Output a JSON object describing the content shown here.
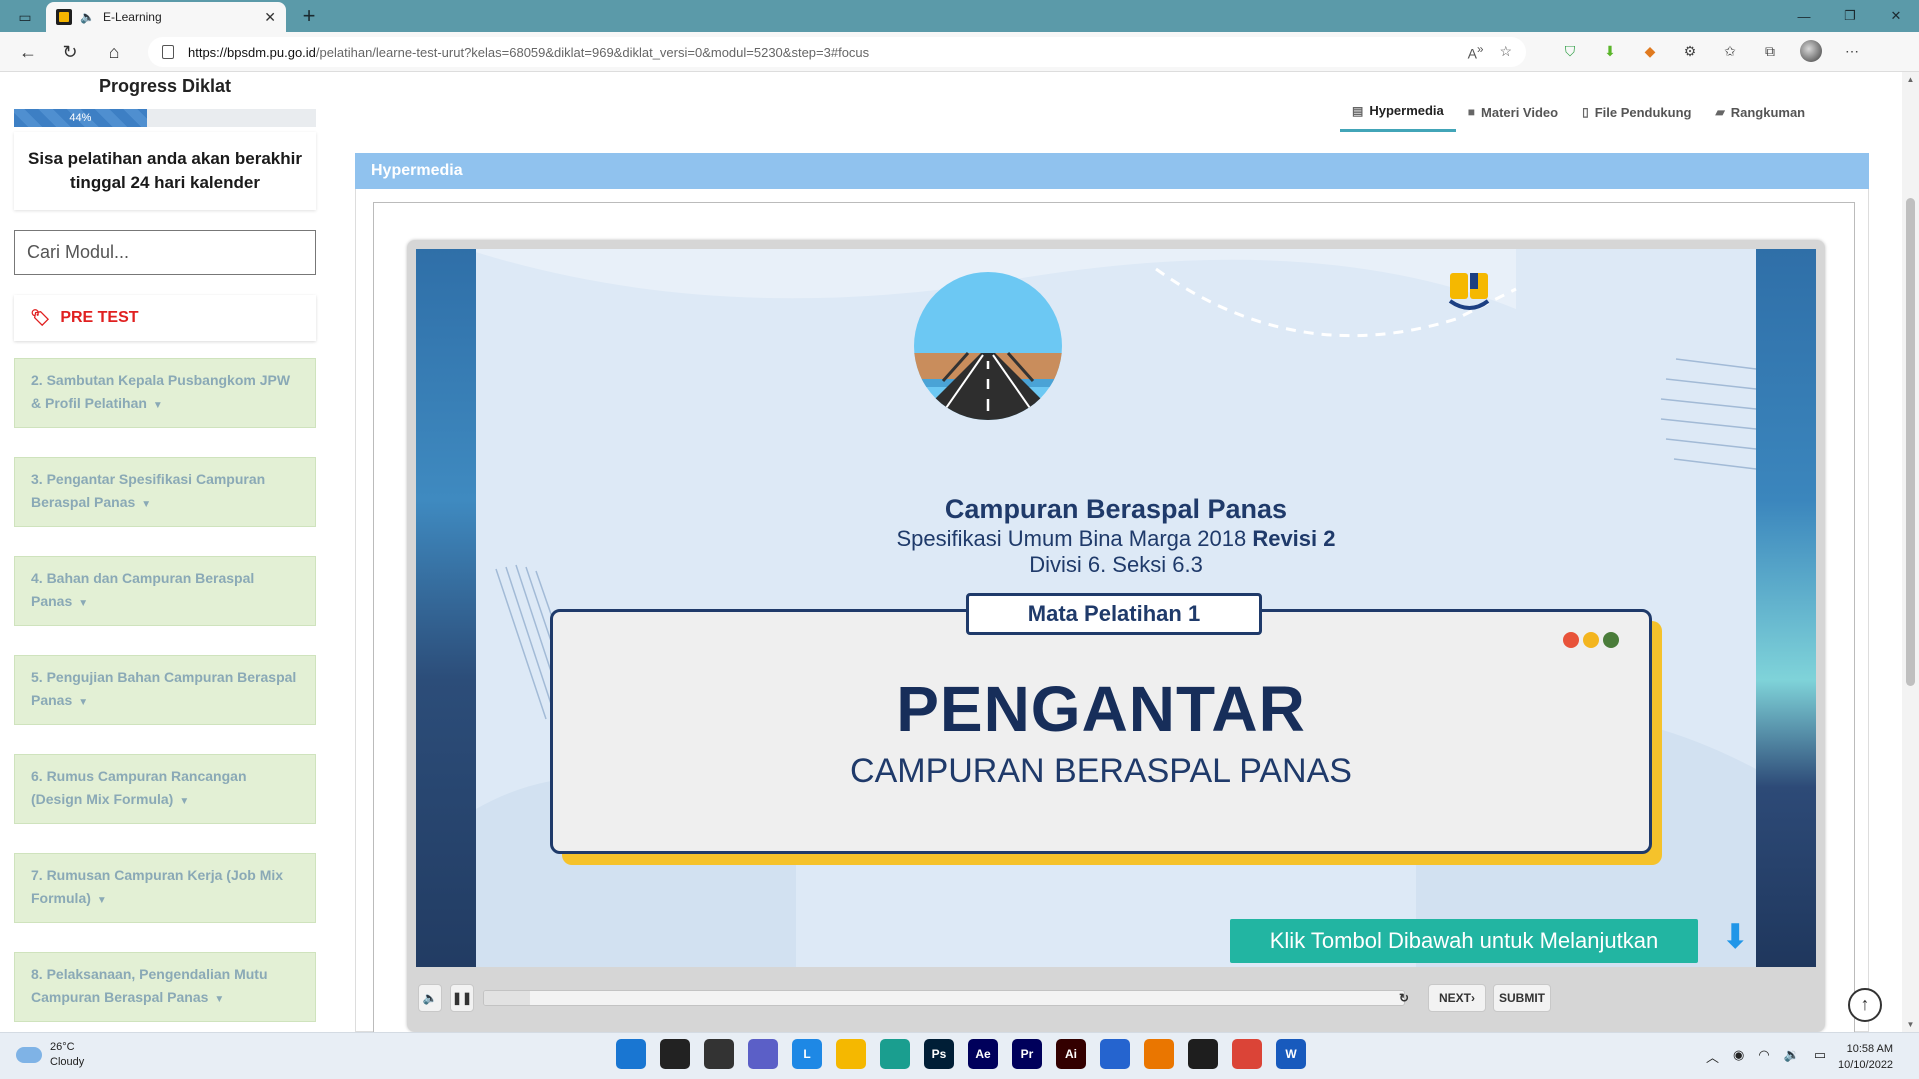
{
  "browser": {
    "tab_title": "E-Learning",
    "url_host": "https://bpsdm.pu.go.id",
    "url_path": "/pelatihan/learne-test-urut?kelas=68059&diklat=969&diklat_versi=0&modul=5230&step=3#focus"
  },
  "sidebar": {
    "progress_title": "Progress Diklat",
    "progress_percent": 44,
    "progress_label": "44%",
    "remaining_text": "Sisa pelatihan anda akan berakhir tinggal 24 hari kalender",
    "search_placeholder": "Cari Modul...",
    "pretest_label": "PRE TEST",
    "modules": [
      {
        "line1": "2. Sambutan Kepala Pusbangkom JPW",
        "line2": "& Profil Pelatihan"
      },
      {
        "line1": "3. Pengantar Spesifikasi Campuran",
        "line2": "Beraspal Panas"
      },
      {
        "line1": "4. Bahan dan Campuran Beraspal",
        "line2": "Panas"
      },
      {
        "line1": "5. Pengujian Bahan Campuran Beraspal",
        "line2": "Panas"
      },
      {
        "line1": "6. Rumus Campuran Rancangan",
        "line2": "(Design Mix Formula)"
      },
      {
        "line1": "7. Rumusan Campuran Kerja (Job Mix",
        "line2": "Formula)"
      },
      {
        "line1": "8. Pelaksanaan, Pengendalian Mutu",
        "line2": "Campuran Beraspal Panas"
      }
    ]
  },
  "content_tabs": {
    "hypermedia": "Hypermedia",
    "materi_video": "Materi Video",
    "file_pendukung": "File Pendukung",
    "rangkuman": "Rangkuman"
  },
  "panel": {
    "title": "Hypermedia"
  },
  "slide": {
    "title": "Campuran Beraspal Panas",
    "subtitle_prefix": "Spesifikasi Umum Bina Marga 2018",
    "subtitle_bold": "Revisi 2",
    "division": "Divisi 6. Seksi 6.3",
    "tag": "Mata Pelatihan 1",
    "heading": "PENGANTAR",
    "subheading": "CAMPURAN BERASPAL PANAS",
    "cta": "Klik Tombol Dibawah untuk Melanjutkan",
    "dot_colors": [
      "#e8533a",
      "#f3b51f",
      "#4a7c3a"
    ]
  },
  "player": {
    "next_label": "NEXT",
    "submit_label": "SUBMIT",
    "seek_progress": 0.05
  },
  "taskbar": {
    "temperature": "26°C",
    "weather": "Cloudy",
    "time": "10:58 AM",
    "date": "10/10/2022",
    "apps": [
      {
        "name": "windows-start",
        "label": "",
        "color": "#1976d2"
      },
      {
        "name": "search",
        "label": "",
        "color": "#222"
      },
      {
        "name": "task-view",
        "label": "",
        "color": "#333"
      },
      {
        "name": "chat",
        "label": "",
        "color": "#5b5fc7"
      },
      {
        "name": "lumina",
        "label": "L",
        "color": "#1e88e5"
      },
      {
        "name": "file-explorer",
        "label": "",
        "color": "#f5b800"
      },
      {
        "name": "edge",
        "label": "",
        "color": "#1a9e8f"
      },
      {
        "name": "photoshop",
        "label": "Ps",
        "color": "#001e36"
      },
      {
        "name": "after-effects",
        "label": "Ae",
        "color": "#00005b"
      },
      {
        "name": "premiere",
        "label": "Pr",
        "color": "#00005b"
      },
      {
        "name": "illustrator",
        "label": "Ai",
        "color": "#330000"
      },
      {
        "name": "todo",
        "label": "",
        "color": "#2564cf"
      },
      {
        "name": "blender",
        "label": "",
        "color": "#ea7600"
      },
      {
        "name": "figma",
        "label": "",
        "color": "#1e1e1e"
      },
      {
        "name": "chrome",
        "label": "",
        "color": "#db4437"
      },
      {
        "name": "word",
        "label": "W",
        "color": "#185abd"
      }
    ]
  }
}
